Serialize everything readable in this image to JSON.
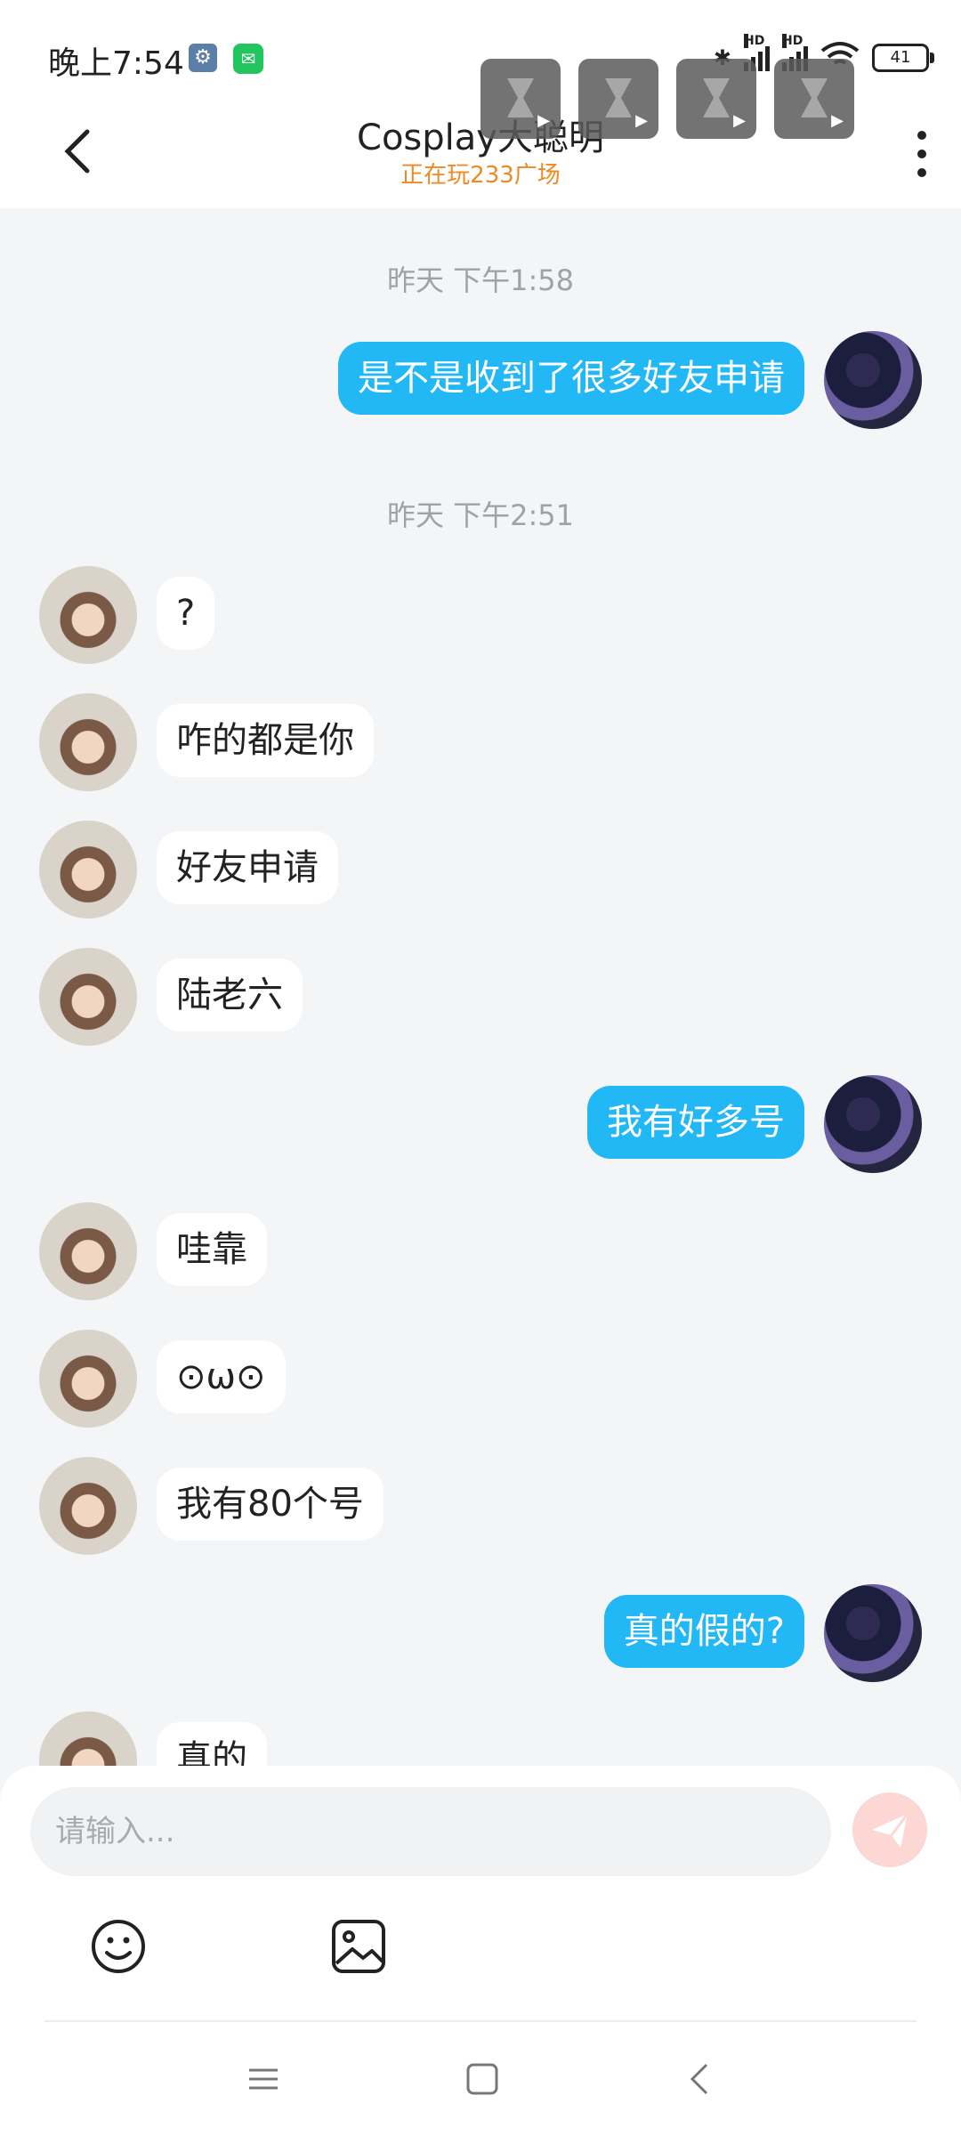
{
  "status_bar": {
    "time": "晚上7:54",
    "battery": "41",
    "network_label": "HD"
  },
  "header": {
    "title": "Cosplay大聪明",
    "subtitle": "正在玩233广场"
  },
  "chat": {
    "timestamps": [
      "昨天 下午1:58",
      "昨天 下午2:51"
    ],
    "messages": [
      {
        "side": "right",
        "text": "是不是收到了很多好友申请"
      },
      {
        "side": "left",
        "text": "?"
      },
      {
        "side": "left",
        "text": "咋的都是你"
      },
      {
        "side": "left",
        "text": "好友申请"
      },
      {
        "side": "left",
        "text": "陆老六"
      },
      {
        "side": "right",
        "text": "我有好多号"
      },
      {
        "side": "left",
        "text": "哇靠"
      },
      {
        "side": "left",
        "text": "⊙ω⊙"
      },
      {
        "side": "left",
        "text": "我有80个号"
      },
      {
        "side": "right",
        "text": "真的假的?"
      },
      {
        "side": "left",
        "text": "真的"
      }
    ]
  },
  "input": {
    "placeholder": "请输入..."
  },
  "colors": {
    "accent": "#22b7f5",
    "subtitle": "#ee8a21",
    "send_disabled": "#fdd7d3"
  }
}
